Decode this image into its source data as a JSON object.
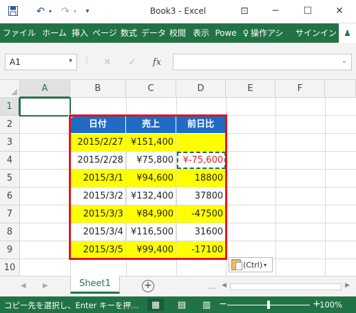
{
  "window": {
    "title": "Book3 - Excel",
    "undo_symbol": "↶",
    "redo_symbol": "↷",
    "customize_symbol": "▾",
    "help_symbol": "⊡",
    "minimize_symbol": "─",
    "restore_symbol": "☐",
    "close_symbol": "✕"
  },
  "ribbon": {
    "tabs": [
      "ファイル",
      "ホーム",
      "挿入",
      "ページ",
      "数式",
      "データ",
      "校閲",
      "表示",
      "Powe",
      "操作アシ",
      "サインイン"
    ],
    "tell_me_icon": "lightbulb-icon",
    "tell_me_symbol": "♀",
    "share_symbol": "♟"
  },
  "formula_bar": {
    "name_box": "A1",
    "name_box_arrow": "▾",
    "separator_symbol": "⋮",
    "cancel_symbol": "✕",
    "enter_symbol": "✓",
    "fx_label": "fx",
    "formula": "",
    "expand_symbol": "⌄"
  },
  "grid": {
    "columns": [
      "A",
      "B",
      "C",
      "D",
      "E",
      "F"
    ],
    "rows": [
      "1",
      "2",
      "3",
      "4",
      "5",
      "6",
      "7",
      "8",
      "9",
      "10"
    ],
    "active_cell": "A1"
  },
  "table": {
    "headers": [
      "日付",
      "売上",
      "前日比"
    ],
    "header_color": "#1F6CC4",
    "highlight_color": "#FFFF00",
    "border_color": "#E0141E",
    "rows": [
      {
        "date": "2015/2/27",
        "sales": "¥151,400",
        "diff": "",
        "highlight": true
      },
      {
        "date": "2015/2/28",
        "sales": "¥75,800",
        "diff": "¥-75,600",
        "highlight": false
      },
      {
        "date": "2015/3/1",
        "sales": "¥94,600",
        "diff": "18800",
        "highlight": true
      },
      {
        "date": "2015/3/2",
        "sales": "¥132,400",
        "diff": "37800",
        "highlight": false
      },
      {
        "date": "2015/3/3",
        "sales": "¥84,900",
        "diff": "-47500",
        "highlight": true
      },
      {
        "date": "2015/3/4",
        "sales": "¥116,500",
        "diff": "31600",
        "highlight": false
      },
      {
        "date": "2015/3/5",
        "sales": "¥99,400",
        "diff": "-17100",
        "highlight": true
      }
    ]
  },
  "paste_options": {
    "label": "(Ctrl)",
    "arrow": "▾"
  },
  "sheets": {
    "tabs": [
      "Sheet1"
    ],
    "prev_symbol": "◀",
    "next_symbol": "▶",
    "more_symbol": "…",
    "add_symbol": "+",
    "scroll_left_symbol": "◀",
    "scroll_right_symbol": "▶"
  },
  "status": {
    "message": "コピー先を選択し、Enter キーを押…",
    "normal_view_symbol": "▦",
    "page_layout_symbol": "▤",
    "page_break_symbol": "▥",
    "zoom_minus": "−",
    "zoom_plus": "+",
    "zoom": "100%",
    "zoom_level": 1.0
  }
}
